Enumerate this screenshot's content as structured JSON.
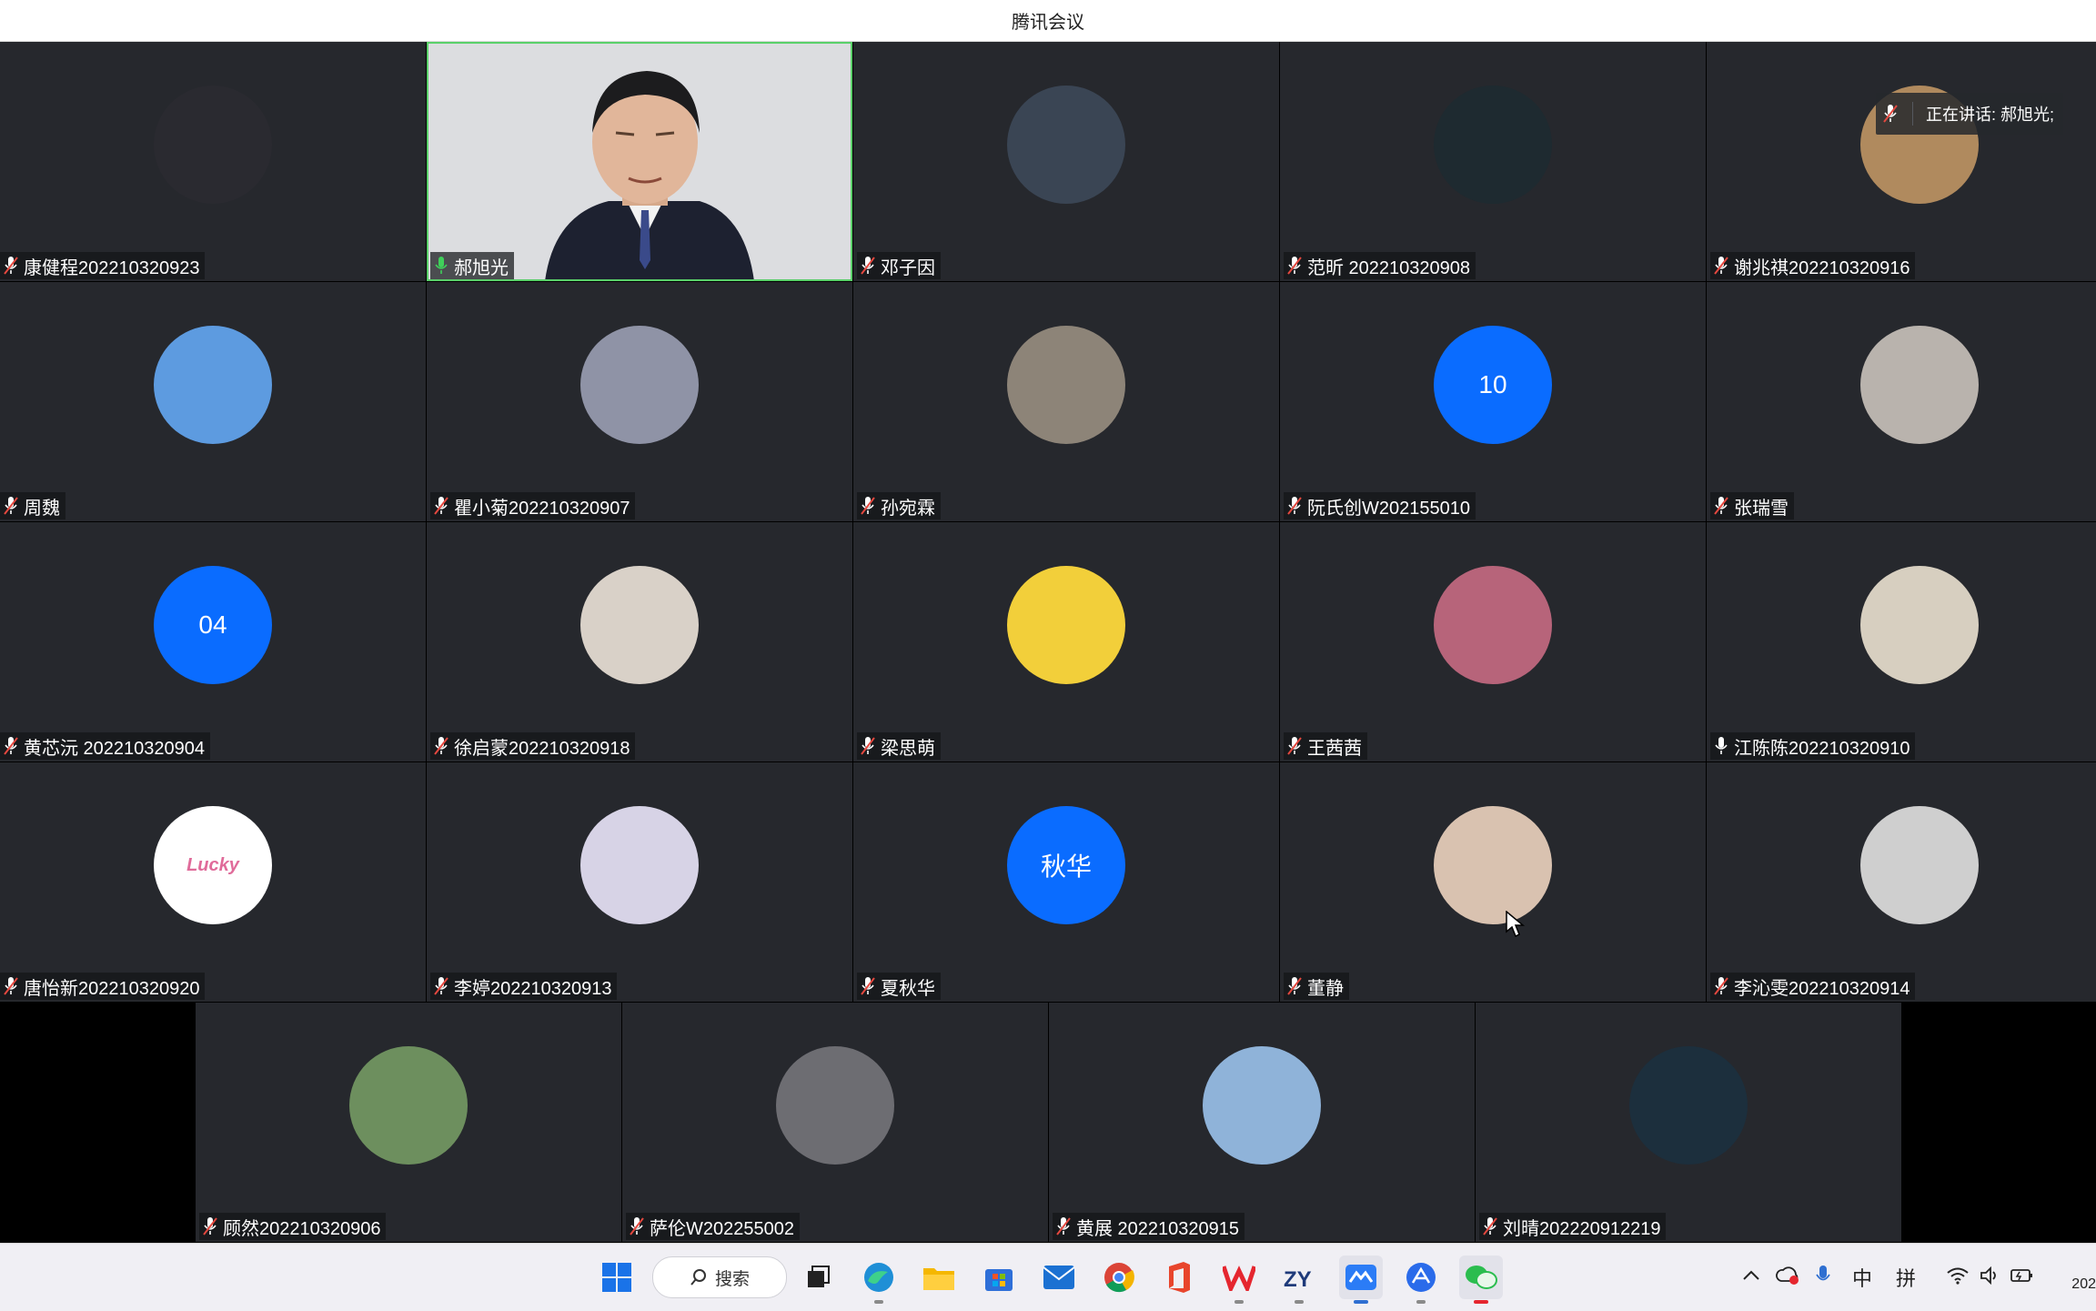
{
  "window": {
    "title": "腾讯会议"
  },
  "speaking_indicator": {
    "label": "正在讲话: 郝旭光;"
  },
  "participants": [
    {
      "name": "康健程202210320923",
      "avatar": "robot-toy-photo",
      "avatar_color": "#2a2a30",
      "mic": "muted"
    },
    {
      "name": "郝旭光",
      "video": true,
      "mic": "active"
    },
    {
      "name": "邓子因",
      "avatar": "anime-boy",
      "avatar_color": "#3a4554",
      "mic": "muted"
    },
    {
      "name": "范昕 202210320908",
      "avatar": "tiger-dark",
      "avatar_color": "#1e2a30",
      "mic": "muted"
    },
    {
      "name": "谢兆祺202210320916",
      "avatar": "person-jacket",
      "avatar_color": "#b08a5e",
      "mic": "muted"
    },
    {
      "name": "周魏",
      "avatar": "sky-clouds",
      "avatar_color": "#5d9be0",
      "mic": "muted"
    },
    {
      "name": "瞿小菊202210320907",
      "avatar": "girl-yellow-hood",
      "avatar_color": "#8f93a6",
      "mic": "muted"
    },
    {
      "name": "孙宛霖",
      "avatar": "girl-warehouse",
      "avatar_color": "#8d8478",
      "mic": "muted"
    },
    {
      "name": "阮氏创W202155010",
      "initials": "10",
      "avatar_color": "#0a6cff",
      "mic": "muted"
    },
    {
      "name": "张瑞雪",
      "avatar": "woman-phone",
      "avatar_color": "#b9b3ad",
      "mic": "muted"
    },
    {
      "name": "黄芯沅 202210320904",
      "initials": "04",
      "avatar_color": "#0a6cff",
      "mic": "muted"
    },
    {
      "name": "徐启蒙202210320918",
      "avatar": "white-cat",
      "avatar_color": "#d9d1c8",
      "mic": "muted"
    },
    {
      "name": "梁思萌",
      "avatar": "yellow-binoculars",
      "avatar_color": "#f2cf3a",
      "mic": "muted"
    },
    {
      "name": "王茜茜",
      "avatar": "sunset-rabbit",
      "avatar_color": "#b7647a",
      "mic": "muted"
    },
    {
      "name": "江陈陈202210320910",
      "avatar": "abstract-face",
      "avatar_color": "#d7cfc0",
      "mic": "on"
    },
    {
      "name": "唐怡新202210320920",
      "avatar": "lucky-bunny",
      "avatar_color": "#ffffff",
      "mic": "muted",
      "avatar_text": "Lucky"
    },
    {
      "name": "李婷202210320913",
      "avatar": "panda-cartoon",
      "avatar_color": "#d7d3e6",
      "mic": "muted"
    },
    {
      "name": "夏秋华",
      "initials": "秋华",
      "avatar_color": "#0a6cff",
      "mic": "muted"
    },
    {
      "name": "董静",
      "avatar": "girl-bangs",
      "avatar_color": "#d9c2b0",
      "mic": "muted"
    },
    {
      "name": "李沁雯202210320914",
      "avatar": "anime-sketch",
      "avatar_color": "#cfcfcf",
      "mic": "muted"
    },
    {
      "name": "顾然202210320906",
      "avatar": "cartoon-girl-green",
      "avatar_color": "#6d8f5e",
      "mic": "muted"
    },
    {
      "name": "萨伦W202255002",
      "avatar": "man-sunglasses",
      "avatar_color": "#6d6d72",
      "mic": "muted"
    },
    {
      "name": "黄展 202210320915",
      "avatar": "flying-pig",
      "avatar_color": "#8fb3d9",
      "mic": "muted"
    },
    {
      "name": "刘晴202220912219",
      "avatar": "ocean-aerial",
      "avatar_color": "#1c2f3d",
      "mic": "muted"
    }
  ],
  "taskbar": {
    "search_label": "搜索",
    "apps": [
      "windows-start-icon",
      "task-view-icon",
      "edge-icon",
      "file-explorer-icon",
      "store-icon",
      "mail-icon",
      "chrome-icon",
      "office-icon",
      "wps-icon",
      "zy-app-icon",
      "tencent-meeting-icon",
      "feishu-icon",
      "wechat-icon"
    ],
    "ime_mode": "中",
    "ime_name": "拼",
    "clock_fragment": "202"
  }
}
